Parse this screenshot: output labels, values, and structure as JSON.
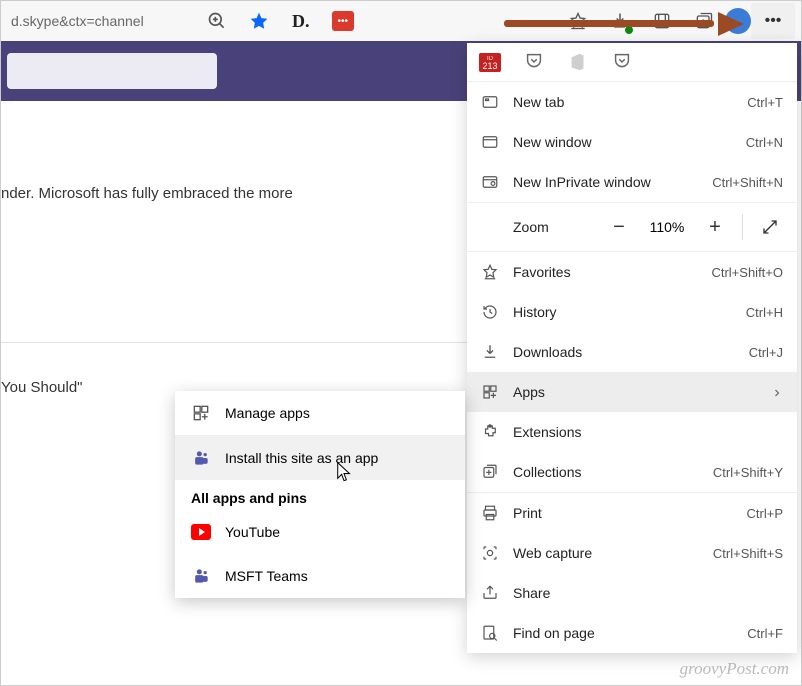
{
  "toolbar": {
    "url_fragment": "d.skype&ctx=channel",
    "cal_badge": "213"
  },
  "page": {
    "line1": "nder. Microsoft has fully embraced the more",
    "line2": "You Should\""
  },
  "menu": {
    "new_tab": {
      "label": "New tab",
      "shortcut": "Ctrl+T"
    },
    "new_window": {
      "label": "New window",
      "shortcut": "Ctrl+N"
    },
    "new_inprivate": {
      "label": "New InPrivate window",
      "shortcut": "Ctrl+Shift+N"
    },
    "zoom": {
      "label": "Zoom",
      "value": "110%"
    },
    "favorites": {
      "label": "Favorites",
      "shortcut": "Ctrl+Shift+O"
    },
    "history": {
      "label": "History",
      "shortcut": "Ctrl+H"
    },
    "downloads": {
      "label": "Downloads",
      "shortcut": "Ctrl+J"
    },
    "apps": {
      "label": "Apps"
    },
    "extensions": {
      "label": "Extensions"
    },
    "collections": {
      "label": "Collections",
      "shortcut": "Ctrl+Shift+Y"
    },
    "print": {
      "label": "Print",
      "shortcut": "Ctrl+P"
    },
    "web_capture": {
      "label": "Web capture",
      "shortcut": "Ctrl+Shift+S"
    },
    "share": {
      "label": "Share"
    },
    "find": {
      "label": "Find on page",
      "shortcut": "Ctrl+F"
    }
  },
  "submenu": {
    "manage": "Manage apps",
    "install": "Install this site as an app",
    "header": "All apps and pins",
    "app1": "YouTube",
    "app2": "MSFT Teams"
  },
  "watermark": "groovyPost.com"
}
